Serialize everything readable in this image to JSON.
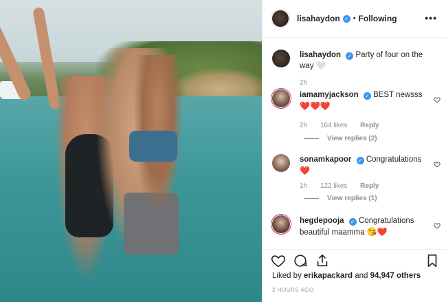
{
  "post": {
    "username": "lisahaydon",
    "follow_state": "Following",
    "caption": {
      "username": "lisahaydon",
      "text": "Party of four on the way 🤍",
      "time": "2h"
    },
    "comments": [
      {
        "username": "iamamyjackson",
        "text": "BEST newsss",
        "emoji": "❤️❤️❤️",
        "time": "2h",
        "likes": "164 likes",
        "reply": "Reply",
        "view_replies": "View replies (2)"
      },
      {
        "username": "sonamkapoor",
        "text": "Congratulations",
        "emoji": "❤️",
        "time": "1h",
        "likes": "122 likes",
        "reply": "Reply",
        "view_replies": "View replies (1)"
      },
      {
        "username": "hegdepooja",
        "text": "Congratulations beautiful maamma",
        "emoji": "😘❤️",
        "time": "",
        "likes": "",
        "reply": "",
        "view_replies": ""
      }
    ],
    "liked_by_user": "erikapackard",
    "others": "94,947 others",
    "posted_ago": "2 HOURS AGO"
  },
  "icons": {
    "more": "more-options-icon",
    "verified": "verified-badge-icon",
    "like": "heart-icon",
    "comment": "comment-icon",
    "share": "share-icon",
    "save": "bookmark-icon"
  },
  "colors": {
    "verified": "#3897f0",
    "secondary_text": "#8e8e8e",
    "heart": "#e0245e"
  }
}
